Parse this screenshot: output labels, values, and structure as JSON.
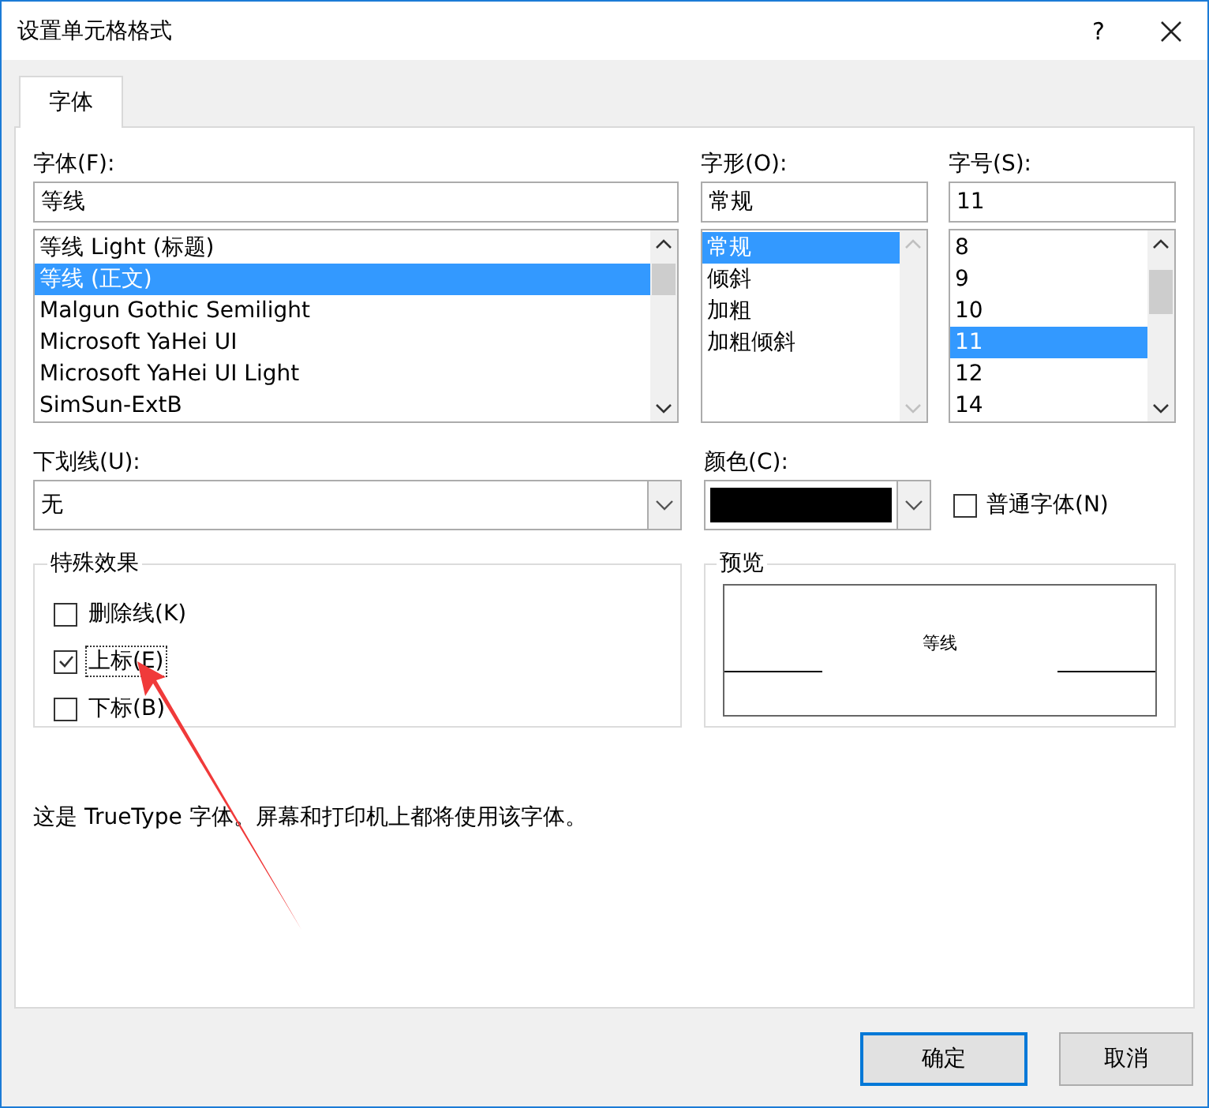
{
  "window": {
    "title": "设置单元格格式",
    "help": "?"
  },
  "tabs": [
    {
      "label": "字体",
      "selected": true
    }
  ],
  "font": {
    "label": "字体(F):",
    "value": "等线",
    "items": [
      {
        "label": "等线 Light (标题)",
        "selected": false
      },
      {
        "label": "等线 (正文)",
        "selected": true
      },
      {
        "label": "Malgun Gothic Semilight",
        "selected": false
      },
      {
        "label": "Microsoft YaHei UI",
        "selected": false
      },
      {
        "label": "Microsoft YaHei UI Light",
        "selected": false
      },
      {
        "label": "SimSun-ExtB",
        "selected": false
      }
    ]
  },
  "style": {
    "label": "字形(O):",
    "value": "常规",
    "items": [
      {
        "label": "常规",
        "selected": true
      },
      {
        "label": "倾斜",
        "selected": false
      },
      {
        "label": "加粗",
        "selected": false
      },
      {
        "label": "加粗倾斜",
        "selected": false
      }
    ]
  },
  "size": {
    "label": "字号(S):",
    "value": "11",
    "items": [
      {
        "label": "8",
        "selected": false
      },
      {
        "label": "9",
        "selected": false
      },
      {
        "label": "10",
        "selected": false
      },
      {
        "label": "11",
        "selected": true
      },
      {
        "label": "12",
        "selected": false
      },
      {
        "label": "14",
        "selected": false
      }
    ]
  },
  "underline": {
    "label": "下划线(U):",
    "value": "无"
  },
  "color": {
    "label": "颜色(C):",
    "color": "#000000"
  },
  "normal_font": {
    "label": "普通字体(N)",
    "checked": false
  },
  "effects": {
    "title": "特殊效果",
    "items": [
      {
        "label": "删除线(K)",
        "checked": false
      },
      {
        "label": "上标(E)",
        "checked": true
      },
      {
        "label": "下标(B)",
        "checked": false
      }
    ]
  },
  "preview": {
    "title": "预览",
    "sample": "等线"
  },
  "description": "这是 TrueType 字体。屏幕和打印机上都将使用该字体。",
  "buttons": [
    {
      "label": "确定",
      "default": true
    },
    {
      "label": "取消",
      "default": false
    }
  ]
}
